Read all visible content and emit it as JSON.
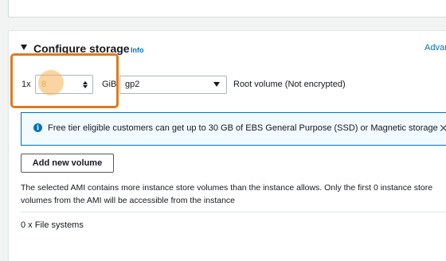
{
  "section": {
    "title": "Configure storage",
    "info_link": "Info",
    "advanced_link": "Advanced"
  },
  "volume": {
    "quantity": "1x",
    "size_value": "8",
    "size_unit": "GiB",
    "type": "gp2",
    "description": "Root volume  (Not encrypted)"
  },
  "alert": {
    "icon": "info-icon",
    "text": "Free tier eligible customers can get up to 30 GB of EBS General Purpose (SSD) or Magnetic storage",
    "close": "✕"
  },
  "add_volume_button": "Add new volume",
  "notice": "The selected AMI contains more instance store volumes than the instance allows. Only the first 0 instance store volumes from the AMI will be accessible from the instance",
  "file_systems": "0 x File systems",
  "colors": {
    "accent": "#0073bb",
    "highlight": "#e07a1b",
    "alert_bg": "#f1faff"
  }
}
